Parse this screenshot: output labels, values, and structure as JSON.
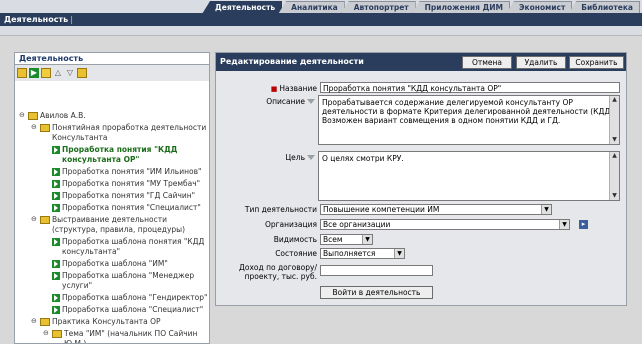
{
  "top_tabs": [
    "Деятельность",
    "Аналитика",
    "Автопортрет",
    "Приложения ДИМ",
    "Экономист",
    "Библиотека"
  ],
  "active_tab": 0,
  "page_title": "Деятельность",
  "left_panel": {
    "title": "Деятельность",
    "tree": [
      {
        "type": "folder",
        "exp": "⊖",
        "indent": 0,
        "label": "Авилов А.В."
      },
      {
        "type": "folder",
        "exp": "⊖",
        "indent": 1,
        "label": "Понятийная проработка деятельности Консультанта"
      },
      {
        "type": "leaf",
        "exp": "",
        "indent": 2,
        "label": "Проработка понятия \"КДД консультанта ОР\"",
        "selected": true
      },
      {
        "type": "leaf",
        "exp": "",
        "indent": 2,
        "label": "Проработка понятия \"ИМ Ильинов\""
      },
      {
        "type": "leaf",
        "exp": "",
        "indent": 2,
        "label": "Проработка понятия \"МУ Трембач\""
      },
      {
        "type": "leaf",
        "exp": "",
        "indent": 2,
        "label": "Проработка понятия \"ГД Сайчин\""
      },
      {
        "type": "leaf",
        "exp": "",
        "indent": 2,
        "label": "Проработка понятия \"Специалист\""
      },
      {
        "type": "folder",
        "exp": "⊖",
        "indent": 1,
        "label": "Выстраивание деятельности (структура, правила, процедуры)"
      },
      {
        "type": "leaf",
        "exp": "",
        "indent": 2,
        "label": "Проработка шаблона понятия \"КДД консультанта\""
      },
      {
        "type": "leaf",
        "exp": "",
        "indent": 2,
        "label": "Проработка шаблона \"ИМ\""
      },
      {
        "type": "leaf",
        "exp": "",
        "indent": 2,
        "label": "Проработка шаблона \"Менеджер услуги\""
      },
      {
        "type": "leaf",
        "exp": "",
        "indent": 2,
        "label": "Проработка шаблона \"Гендиректор\""
      },
      {
        "type": "leaf",
        "exp": "",
        "indent": 2,
        "label": "Проработка шаблона \"Специалист\""
      },
      {
        "type": "folder",
        "exp": "⊖",
        "indent": 1,
        "label": "Практика Консультанта ОР"
      },
      {
        "type": "folder",
        "exp": "⊖",
        "indent": 2,
        "label": "Тема \"ИМ\" (начальник ПО Сайчин Ю.М.)"
      }
    ]
  },
  "editor": {
    "title": "Редактирование деятельности",
    "buttons": {
      "cancel": "Отмена",
      "delete": "Удалить",
      "save": "Сохранить"
    },
    "required_mark": "■",
    "name_label": "Название",
    "name_value": "Проработка понятия \"КДД консультанта ОР\"",
    "description_label": "Описание",
    "description_value": "Прорабатывается содержание делегируемой консультанту ОР деятельности в формате Критерия делегированной деятельности (КДД). Возможен вариант совмещения в одном понятии КДД и ГД.",
    "goal_label": "Цель",
    "goal_value": "О целях смотри КРУ.",
    "type_label": "Тип деятельности",
    "type_value": "Повышение компетенции ИМ",
    "org_label": "Организация",
    "org_value": "Все организации",
    "visibility_label": "Видимость",
    "visibility_value": "Всем",
    "state_label": "Состояние",
    "state_value": "Выполняется",
    "income_label": "Доход по договору/проекту, тыс. руб.",
    "income_value": "",
    "enter_button": "Войти в деятельность"
  }
}
